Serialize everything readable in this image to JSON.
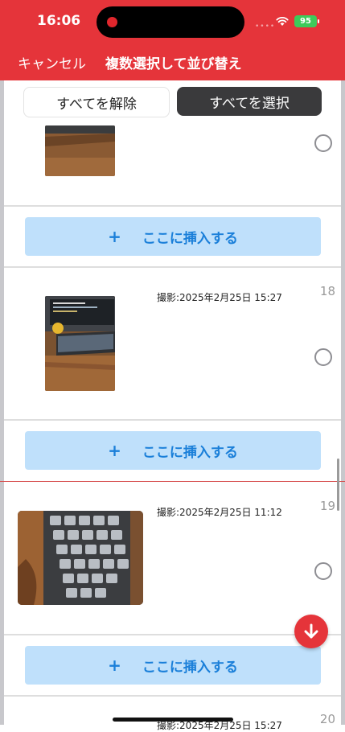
{
  "status_bar": {
    "time": "16:06",
    "battery": "95"
  },
  "header": {
    "cancel_label": "キャンセル",
    "title": "複数選択して並び替え"
  },
  "select_bar": {
    "deselect_all_label": "すべてを解除",
    "select_all_label": "すべてを選択"
  },
  "insert": {
    "plus": "+",
    "label": "ここに挿入する"
  },
  "items": [
    {
      "number": "",
      "date": ""
    },
    {
      "number": "18",
      "date": "撮影:2025年2月25日 15:27"
    },
    {
      "number": "19",
      "date": "撮影:2025年2月25日 11:12"
    },
    {
      "number": "20",
      "date": "撮影:2025年2月25日 15:27"
    }
  ],
  "colors": {
    "header_bg": "#e5343a",
    "insert_bg": "#bfe0fb",
    "insert_text": "#1a7fd9",
    "select_all_bg": "#3a3a3c"
  }
}
